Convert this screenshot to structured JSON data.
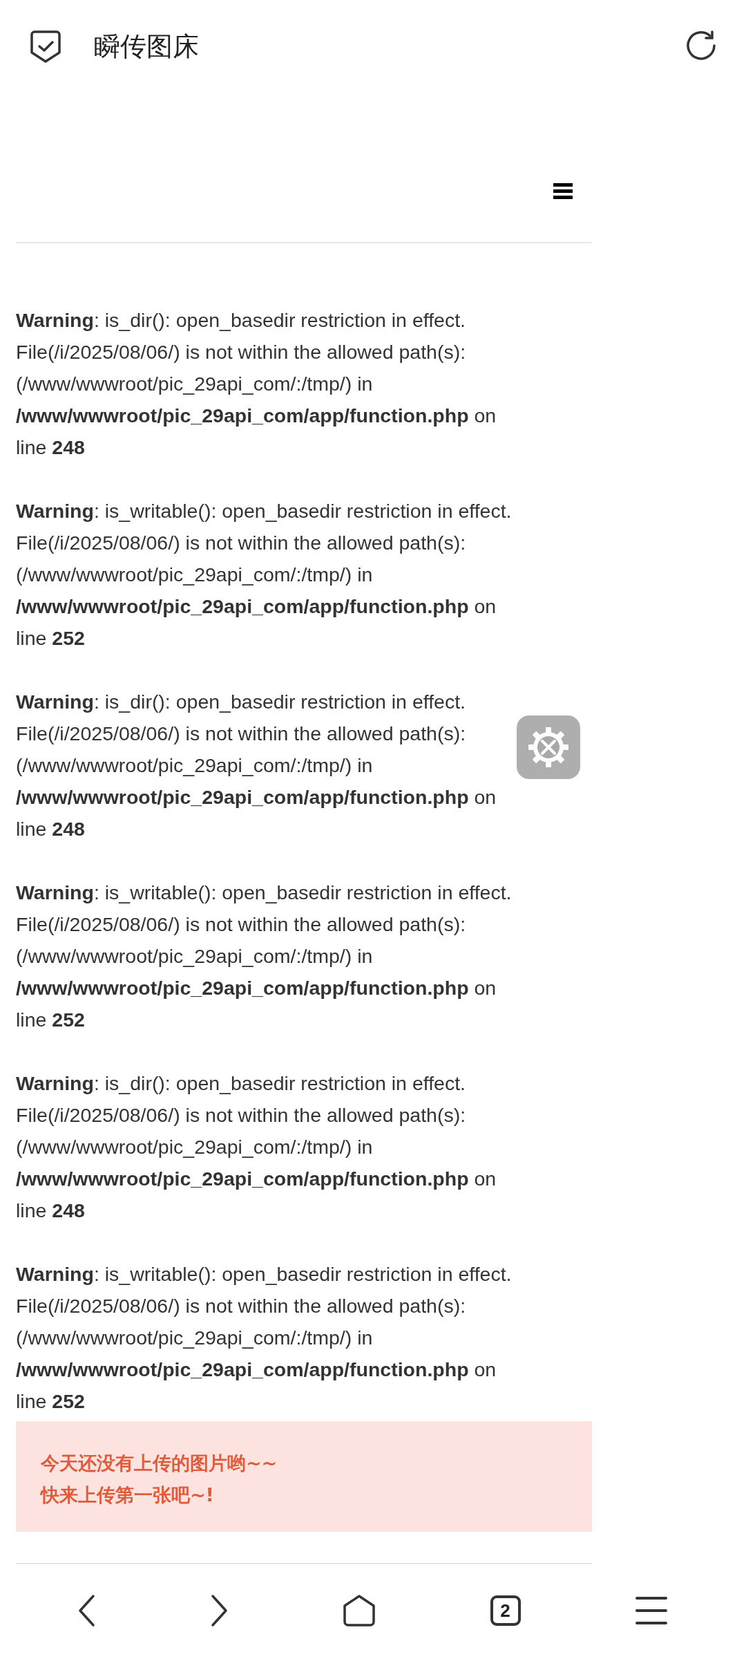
{
  "top_bar": {
    "title": "瞬传图床"
  },
  "warnings": [
    {
      "lines": [
        "**Warning**: is_dir(): open_basedir restriction in effect.",
        "File(/i/2025/08/06/) is not within the allowed path(s):",
        "(/www/wwwroot/pic_29api_com/:/tmp/) in",
        "**/www/wwwroot/pic_29api_com/app/function.php** on",
        "line **248**"
      ]
    },
    {
      "lines": [
        "**Warning**: is_writable(): open_basedir restriction in effect.",
        "File(/i/2025/08/06/) is not within the allowed path(s):",
        "(/www/wwwroot/pic_29api_com/:/tmp/) in",
        "**/www/wwwroot/pic_29api_com/app/function.php** on",
        "line **252**"
      ]
    },
    {
      "lines": [
        "**Warning**: is_dir(): open_basedir restriction in effect.",
        "File(/i/2025/08/06/) is not within the allowed path(s):",
        "(/www/wwwroot/pic_29api_com/:/tmp/) in",
        "**/www/wwwroot/pic_29api_com/app/function.php** on",
        "line **248**"
      ]
    },
    {
      "lines": [
        "**Warning**: is_writable(): open_basedir restriction in effect.",
        "File(/i/2025/08/06/) is not within the allowed path(s):",
        "(/www/wwwroot/pic_29api_com/:/tmp/) in",
        "**/www/wwwroot/pic_29api_com/app/function.php** on",
        "line **252**"
      ]
    },
    {
      "lines": [
        "**Warning**: is_dir(): open_basedir restriction in effect.",
        "File(/i/2025/08/06/) is not within the allowed path(s):",
        "(/www/wwwroot/pic_29api_com/:/tmp/) in",
        "**/www/wwwroot/pic_29api_com/app/function.php** on",
        "line **248**"
      ]
    },
    {
      "lines": [
        "**Warning**: is_writable(): open_basedir restriction in effect.",
        "File(/i/2025/08/06/) is not within the allowed path(s):",
        "(/www/wwwroot/pic_29api_com/:/tmp/) in",
        "**/www/wwwroot/pic_29api_com/app/function.php** on",
        "line **252**"
      ]
    }
  ],
  "notice": {
    "lines": [
      "今天还没有上传的图片哟~~",
      "快来上传第一张吧~!"
    ]
  },
  "bottom_nav": {
    "tab_count": "2"
  }
}
